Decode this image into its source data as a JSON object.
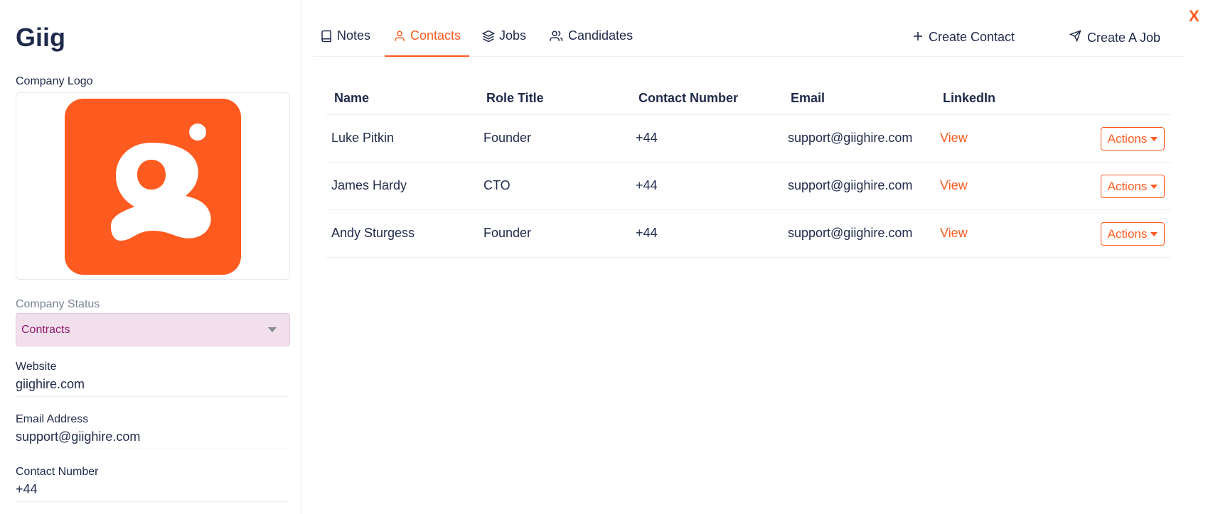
{
  "close_label": "X",
  "company": {
    "name": "Giig",
    "logo_label": "Company Logo",
    "status_label": "Company Status",
    "status_value": "Contracts",
    "website_label": "Website",
    "website_value": "giighire.com",
    "email_label": "Email Address",
    "email_value": "support@giighire.com",
    "contact_label": "Contact Number",
    "contact_value": "+44"
  },
  "tabs": [
    {
      "label": "Notes",
      "icon": "book-icon",
      "active": false
    },
    {
      "label": "Contacts",
      "icon": "user-icon",
      "active": true
    },
    {
      "label": "Jobs",
      "icon": "layers-icon",
      "active": false
    },
    {
      "label": "Candidates",
      "icon": "users-icon",
      "active": false
    }
  ],
  "actions": {
    "create_contact": "Create Contact",
    "create_job": "Create A Job"
  },
  "table": {
    "headers": [
      "Name",
      "Role Title",
      "Contact Number",
      "Email",
      "LinkedIn"
    ],
    "rows": [
      {
        "name": "Luke Pitkin",
        "role": "Founder",
        "phone": "+44",
        "email": "support@giighire.com",
        "linkedin": "View",
        "actions": "Actions"
      },
      {
        "name": "James Hardy",
        "role": "CTO",
        "phone": "+44",
        "email": "support@giighire.com",
        "linkedin": "View",
        "actions": "Actions"
      },
      {
        "name": "Andy Sturgess",
        "role": "Founder",
        "phone": "+44",
        "email": "support@giighire.com",
        "linkedin": "View",
        "actions": "Actions"
      }
    ]
  },
  "colors": {
    "accent": "#ff5a1f",
    "text": "#1e2a4a",
    "status_bg": "#f1dfec",
    "status_text": "#8a1a6a"
  }
}
